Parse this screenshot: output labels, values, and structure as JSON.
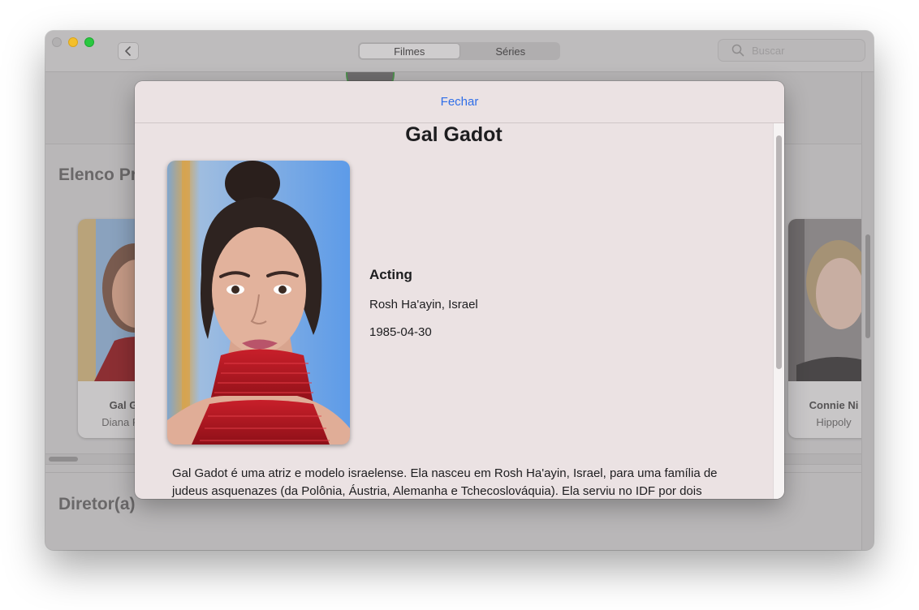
{
  "window": {
    "tabs": [
      {
        "label": "Filmes",
        "active": true
      },
      {
        "label": "Séries",
        "active": false
      }
    ],
    "search": {
      "placeholder": "Buscar",
      "value": ""
    }
  },
  "background": {
    "cast_section_title": "Elenco Pr",
    "director_section_title": "Diretor(a)",
    "cast_cards": [
      {
        "name": "Gal G",
        "role": "Diana Pri"
      },
      {
        "name": "Connie Ni",
        "role": "Hippoly"
      }
    ]
  },
  "sheet": {
    "close_label": "Fechar",
    "name": "Gal Gadot",
    "department": "Acting",
    "place_of_birth": "Rosh Ha'ayin, Israel",
    "birthday": "1985-04-30",
    "biography": "Gal Gadot é uma atriz e modelo israelense. Ela nasceu em Rosh Ha'ayin, Israel, para uma família de judeus asquenazes (da Polônia, Áustria, Alemanha e Tchecoslováquia). Ela serviu no IDF por dois anos, e venceu o concurso de Miss Israel."
  },
  "colors": {
    "accent_link": "#2f6ee8",
    "sheet_background": "#ebe2e3",
    "traffic_minimize": "#f4bf2a",
    "traffic_maximize": "#2ac840"
  }
}
